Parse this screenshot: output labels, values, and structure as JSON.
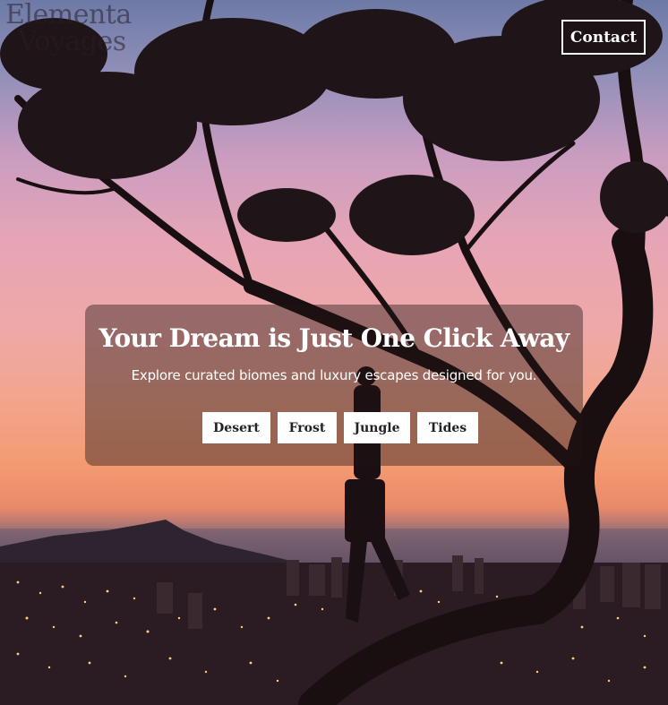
{
  "brand": {
    "line1": "Elementa",
    "line2": "Voyages"
  },
  "nav": {
    "contact_label": "Contact"
  },
  "hero": {
    "title": "Your Dream is Just One Click Away",
    "subtitle": "Explore curated biomes and luxury escapes designed for you.",
    "buttons": [
      "Desert",
      "Frost",
      "Jungle",
      "Tides"
    ]
  },
  "colors": {
    "panel": "#1e1414",
    "button_bg": "#ffffff",
    "button_text": "#222222",
    "sky_top": "#6d7aa6",
    "sky_sunset": "#f49a72"
  },
  "icons": [
    "tree-silhouette",
    "person-silhouette",
    "city-lights",
    "mountain-silhouette"
  ]
}
